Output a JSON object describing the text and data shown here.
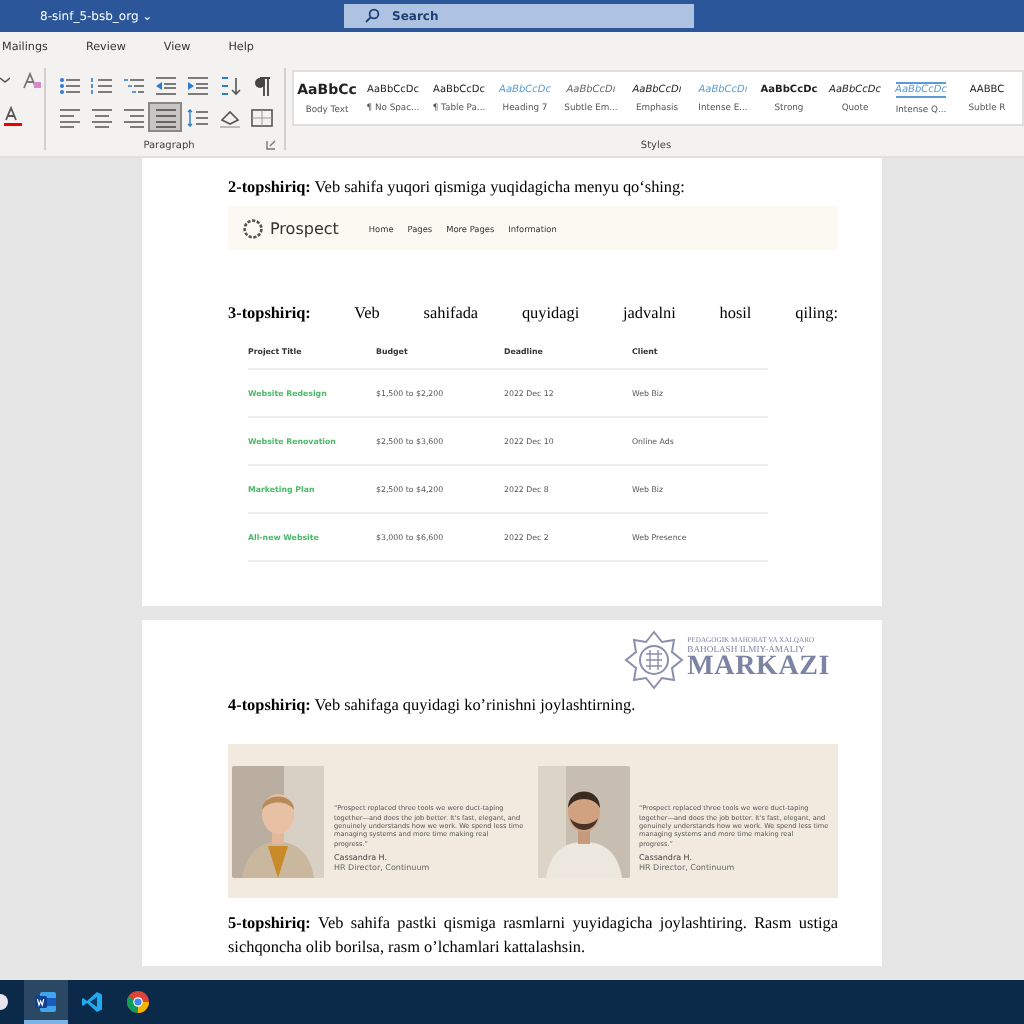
{
  "window": {
    "title": "8-sinf_5-bsb_org",
    "caret": "⌄"
  },
  "search": {
    "placeholder": "Search"
  },
  "menu": [
    "Mailings",
    "Review",
    "View",
    "Help"
  ],
  "paragraph_buttons": [
    {
      "kind": "bullets",
      "selected": false
    },
    {
      "kind": "numbering",
      "selected": false
    },
    {
      "kind": "multilevel",
      "selected": false
    },
    {
      "kind": "outdent",
      "selected": false
    },
    {
      "kind": "indent",
      "selected": false
    },
    {
      "kind": "sort",
      "selected": false
    },
    {
      "kind": "pilcrow",
      "selected": false
    },
    {
      "kind": "align-left",
      "selected": false
    },
    {
      "kind": "align-center",
      "selected": false
    },
    {
      "kind": "align-right",
      "selected": false
    },
    {
      "kind": "justify",
      "selected": true
    },
    {
      "kind": "spacing",
      "selected": false
    },
    {
      "kind": "shading",
      "selected": false
    },
    {
      "kind": "borders",
      "selected": false
    }
  ],
  "groups": [
    "Paragraph",
    "Styles"
  ],
  "styles": [
    {
      "sample": "AaBbCc",
      "name": "Body Text",
      "kind": "big"
    },
    {
      "sample": "AaBbCcDc",
      "name": "¶ No Spac...",
      "kind": "plain"
    },
    {
      "sample": "AaBbCcDc",
      "name": "¶ Table Pa...",
      "kind": "plain"
    },
    {
      "sample": "AaBbCcDc",
      "name": "Heading 7",
      "kind": "accent"
    },
    {
      "sample": "AaBbCcDı",
      "name": "Subtle Em...",
      "kind": "subtle"
    },
    {
      "sample": "AaBbCcDı",
      "name": "Emphasis",
      "kind": "italic"
    },
    {
      "sample": "AaBbCcDı",
      "name": "Intense E...",
      "kind": "accent"
    },
    {
      "sample": "AaBbCcDc",
      "name": "Strong",
      "kind": "bold"
    },
    {
      "sample": "AaBbCcDc",
      "name": "Quote",
      "kind": "italic"
    },
    {
      "sample": "AaBbCcDc",
      "name": "Intense Q...",
      "kind": "quote"
    },
    {
      "sample": "AABBC",
      "name": "Subtle R",
      "kind": "plain"
    }
  ],
  "task2": {
    "text": "**2-topshiriq:** Veb sahifa yuqori qismiga yuqidagicha menyu qo‘shing:",
    "brand": "Prospect",
    "links": [
      "Home",
      "Pages",
      "More Pages",
      "Information"
    ]
  },
  "task3": {
    "text": "**3-topshiriq:** Veb sahifada quyidagi jadvalni hosil qiling:",
    "columns": [
      "Project Title",
      "Budget",
      "Deadline",
      "Client"
    ],
    "rows": [
      [
        "Website Redesign",
        "$1,500 to $2,200",
        "2022 Dec 12",
        "Web Biz"
      ],
      [
        "Website Renovation",
        "$2,500 to $3,600",
        "2022 Dec 10",
        "Online Ads"
      ],
      [
        "Marketing Plan",
        "$2,500 to $4,200",
        "2022 Dec 8",
        "Web Biz"
      ],
      [
        "All-new Website",
        "$3,000 to $6,600",
        "2022 Dec 2",
        "Web Presence"
      ]
    ]
  },
  "logo": {
    "lines": [
      "PEDAGOGIK MAHORAT VA XALQARO",
      "BAHOLASH ILMIY-AMALIY",
      "MARKAZI"
    ]
  },
  "task4": {
    "text": "**4-topshiriq:** Veb sahifaga quyidagi ko’rinishni joylashtirning.",
    "testimonials": [
      {
        "quote": "“Prospect replaced three tools we were duct-taping together—and does the job better. It's fast, elegant, and genuinely understands how we work. We spend less time managing systems and more time making real progress.”",
        "name": "Cassandra H.",
        "role": "HR Director, Continuum",
        "kind": "woman"
      },
      {
        "quote": "“Prospect replaced three tools we were duct-taping together—and does the job better. It's fast, elegant, and genuinely understands how we work. We spend less time managing systems and more time making real progress.”",
        "name": "Cassandra H.",
        "role": "HR Director, Continuum",
        "kind": "man"
      }
    ]
  },
  "task5": {
    "text": "**5-topshiriq:** Veb sahifa pastki qismiga rasmlarni yuyidagicha joylashtiring. Rasm ustiga sichqoncha olib borilsa, rasm o’lchamlari kattalashsin."
  },
  "taskbar": [
    {
      "kind": "word",
      "selected": true
    },
    {
      "kind": "vscode",
      "selected": false
    },
    {
      "kind": "chrome",
      "selected": false
    }
  ]
}
